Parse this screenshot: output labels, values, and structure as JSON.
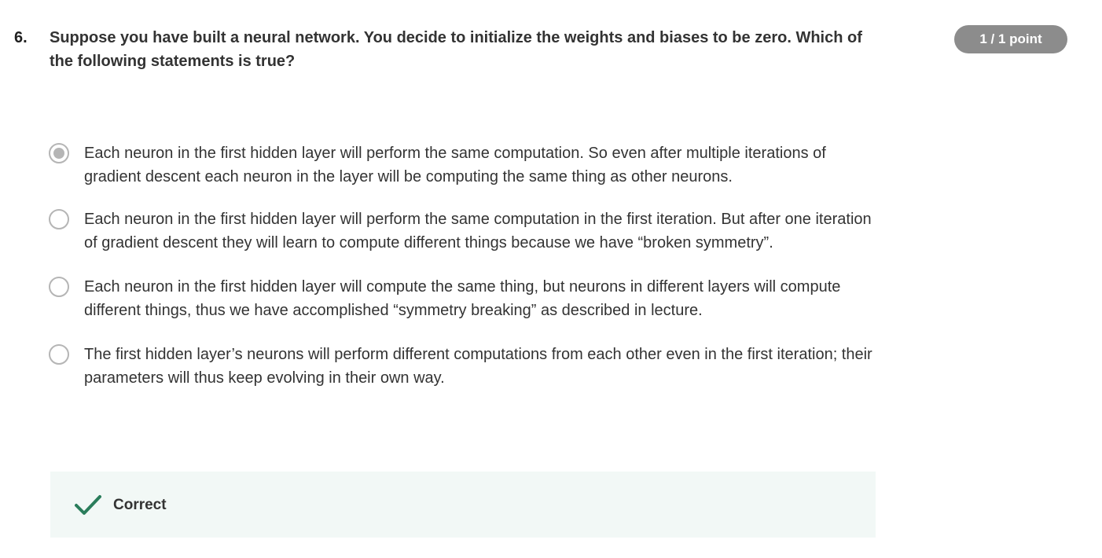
{
  "question": {
    "number": "6.",
    "text": "Suppose you have built a neural network. You decide to initialize the weights and biases to be zero. Which of the following statements is true?",
    "score": "1 / 1 point"
  },
  "options": [
    {
      "text": "Each neuron in the first hidden layer will perform the same computation. So even after multiple iterations of gradient descent each neuron in the layer will be computing the same thing as other neurons.",
      "selected": true
    },
    {
      "text": "Each neuron in the first hidden layer will perform the same computation in the first iteration. But after one iteration of gradient descent they will learn to compute different things because we have “broken symmetry”.",
      "selected": false
    },
    {
      "text": "Each neuron in the first hidden layer will compute the same thing, but neurons in different layers will compute different things, thus we have accomplished “symmetry breaking” as described in lecture.",
      "selected": false
    },
    {
      "text": "The first hidden layer’s neurons will perform different computations from each other even in the first iteration; their parameters will thus keep evolving in their own way.",
      "selected": false
    }
  ],
  "feedback": {
    "label": "Correct",
    "icon": "checkmark-icon"
  },
  "colors": {
    "badge_bg": "#8c8c8c",
    "feedback_bg": "#f2f8f6",
    "check_green": "#2a7d5b",
    "radio_gray": "#b5b5b5"
  }
}
